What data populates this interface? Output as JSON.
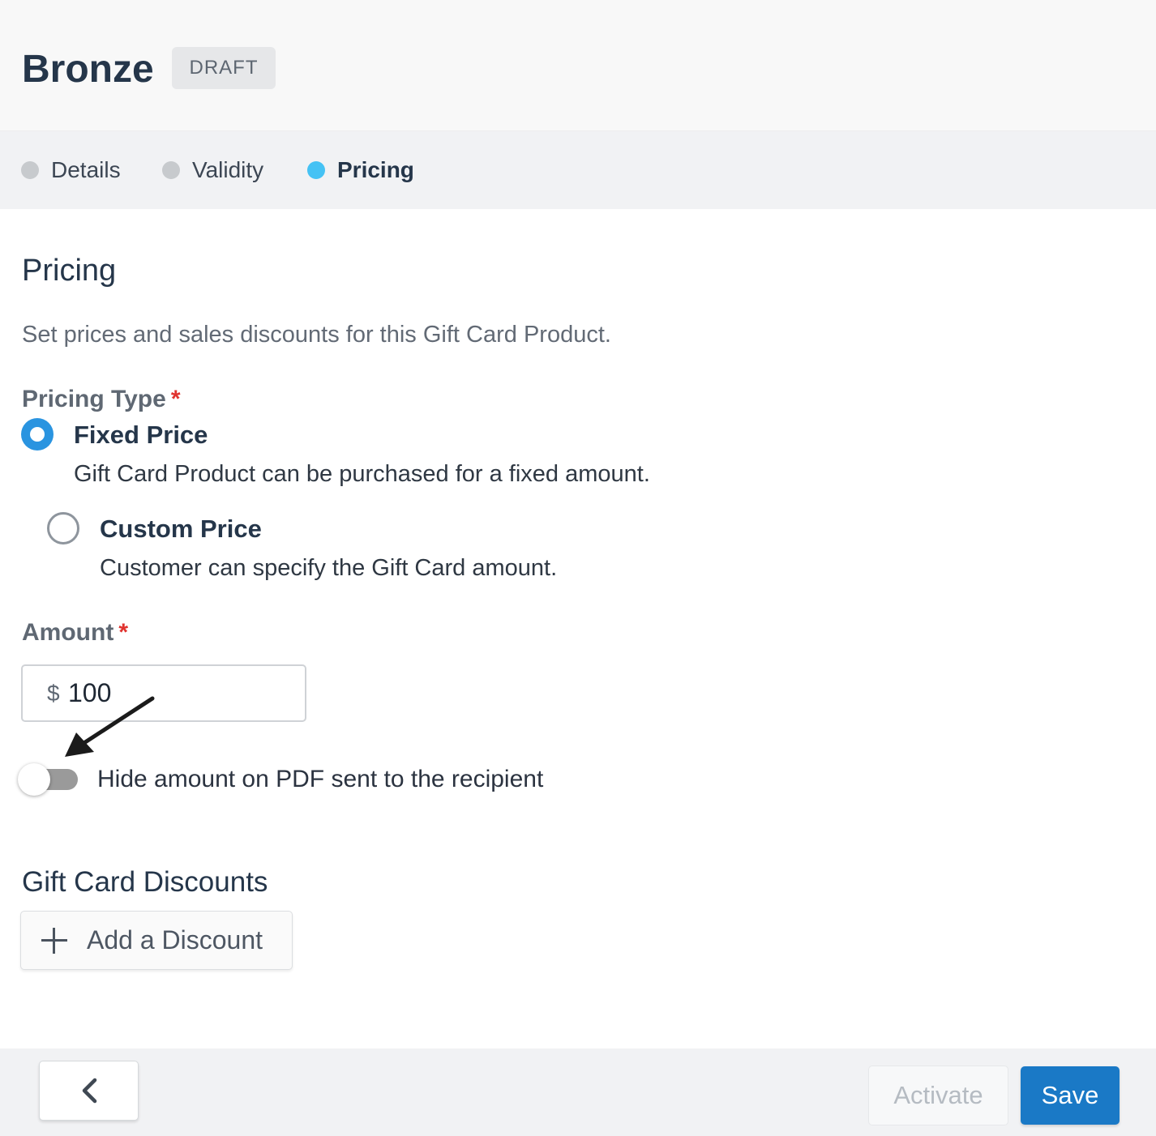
{
  "header": {
    "title": "Bronze",
    "status_badge": "DRAFT"
  },
  "steps": [
    {
      "label": "Details",
      "active": false
    },
    {
      "label": "Validity",
      "active": false
    },
    {
      "label": "Pricing",
      "active": true
    }
  ],
  "pricing": {
    "title": "Pricing",
    "description": "Set prices and sales discounts for this Gift Card Product.",
    "pricing_type": {
      "label": "Pricing Type",
      "required_mark": "*",
      "options": [
        {
          "title": "Fixed Price",
          "description": "Gift Card Product can be purchased for a fixed amount.",
          "selected": true
        },
        {
          "title": "Custom Price",
          "description": "Customer can specify the Gift Card amount.",
          "selected": false
        }
      ]
    },
    "amount": {
      "label": "Amount",
      "required_mark": "*",
      "currency_symbol": "$",
      "value": "100"
    },
    "hide_amount_toggle": {
      "label": "Hide amount on PDF sent to the recipient",
      "enabled": false
    }
  },
  "discounts": {
    "title": "Gift Card Discounts",
    "add_button_label": "Add a Discount"
  },
  "footer": {
    "back_icon": "chevron-left-icon",
    "activate_label": "Activate",
    "save_label": "Save"
  },
  "colors": {
    "accent": "#1a79c6",
    "step_active": "#45c2f4",
    "radio_selected": "#2a94e0",
    "required": "#e0332f"
  }
}
